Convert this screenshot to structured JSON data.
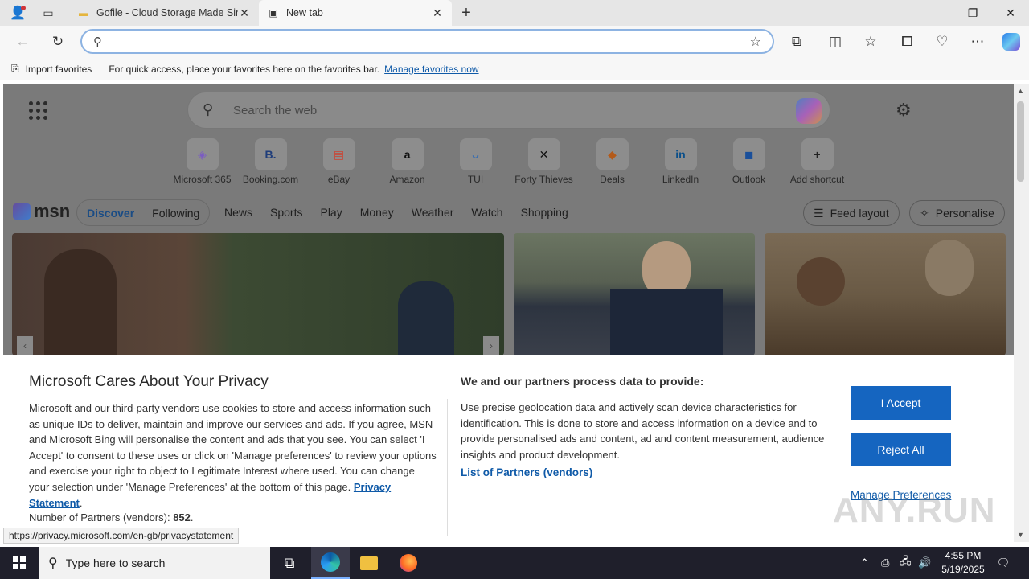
{
  "tabs": [
    {
      "title": "Gofile - Cloud Storage Made Sim",
      "active": false
    },
    {
      "title": "New tab",
      "active": true
    }
  ],
  "address": {
    "value": "",
    "placeholder": ""
  },
  "favorites_bar": {
    "import_label": "Import favorites",
    "message": "For quick access, place your favorites here on the favorites bar.",
    "manage_link": "Manage favorites now"
  },
  "ntp": {
    "search_placeholder": "Search the web",
    "shortcuts": [
      {
        "label": "Microsoft 365",
        "icon": "m365-icon",
        "glyph": "◈",
        "color": "#7b5cc2"
      },
      {
        "label": "Booking.com",
        "icon": "booking-icon",
        "glyph": "B.",
        "color": "#1f3d7a"
      },
      {
        "label": "eBay",
        "icon": "ebay-icon",
        "glyph": "▤",
        "color": "#c43"
      },
      {
        "label": "Amazon",
        "icon": "amazon-icon",
        "glyph": "a",
        "color": "#111"
      },
      {
        "label": "TUI",
        "icon": "tui-icon",
        "glyph": "ᴗ",
        "color": "#3b6fb0"
      },
      {
        "label": "Forty Thieves",
        "icon": "forty-thieves-icon",
        "glyph": "✕",
        "color": "#111"
      },
      {
        "label": "Deals",
        "icon": "deals-icon",
        "glyph": "◆",
        "color": "#b35a1a"
      },
      {
        "label": "LinkedIn",
        "icon": "linkedin-icon",
        "glyph": "in",
        "color": "#0a4f8a"
      },
      {
        "label": "Outlook",
        "icon": "outlook-icon",
        "glyph": "◼",
        "color": "#1a4f9a"
      },
      {
        "label": "Add shortcut",
        "icon": "plus-icon",
        "glyph": "+",
        "color": "#222"
      }
    ],
    "msn": {
      "logo": "msn",
      "pill_tabs": [
        "Discover",
        "Following"
      ],
      "nav": [
        "News",
        "Sports",
        "Play",
        "Money",
        "Weather",
        "Watch",
        "Shopping"
      ],
      "feed_layout": "Feed layout",
      "personalise": "Personalise"
    }
  },
  "privacy": {
    "title": "Microsoft Cares About Your Privacy",
    "body": "Microsoft and our third-party vendors use cookies to store and access information such as unique IDs to deliver, maintain and improve our services and ads. If you agree, MSN and Microsoft Bing will personalise the content and ads that you see. You can select 'I Accept' to consent to these uses or click on 'Manage preferences' to review your options and exercise your right to object to Legitimate Interest where used.  You can change your selection under 'Manage Preferences' at the bottom of this page.",
    "privacy_link": "Privacy Statement",
    "partners_label": "Number of Partners (vendors):",
    "partners_count": "852",
    "subtitle": "We and our partners process data to provide:",
    "body2": "Use precise geolocation data and actively scan device characteristics for identification. This is done to store and access information on a device and to provide personalised ads and content, ad and content measurement, audience insights and product development.",
    "list_partners": "List of Partners (vendors)",
    "accept": "I Accept",
    "reject": "Reject All",
    "manage": "Manage Preferences"
  },
  "status_url": "https://privacy.microsoft.com/en-gb/privacystatement",
  "watermark": "ANY.RUN",
  "taskbar": {
    "search_placeholder": "Type here to search",
    "time": "4:55 PM",
    "date": "5/19/2025"
  },
  "colors": {
    "accent": "#1565c0",
    "link": "#0f5aa8"
  }
}
